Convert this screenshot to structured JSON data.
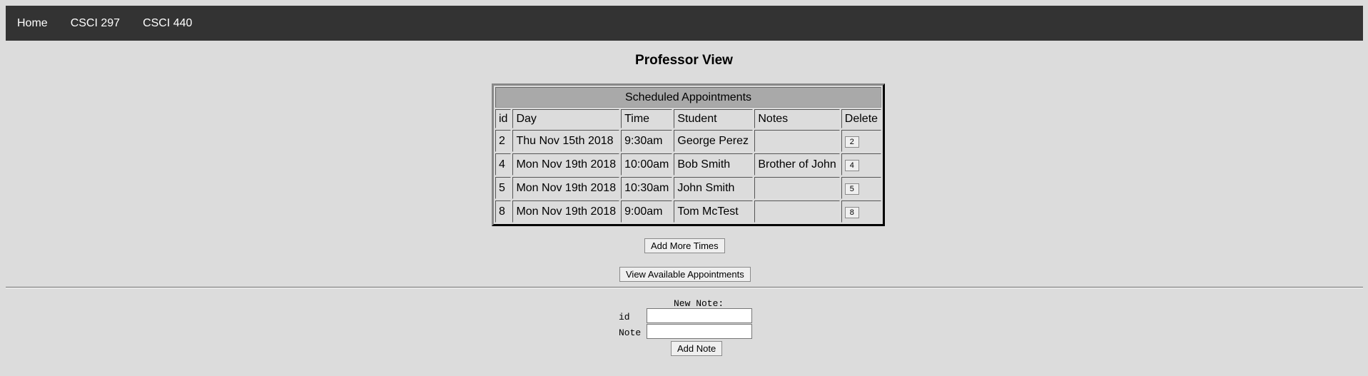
{
  "nav": {
    "links": [
      "Home",
      "CSCI 297",
      "CSCI 440"
    ]
  },
  "page": {
    "title": "Professor View"
  },
  "appointments": {
    "caption": "Scheduled Appointments",
    "headers": [
      "id",
      "Day",
      "Time",
      "Student",
      "Notes",
      "Delete"
    ],
    "rows": [
      {
        "id": "2",
        "day": "Thu Nov 15th 2018",
        "time": "9:30am",
        "student": "George Perez",
        "notes": "",
        "delete": "2"
      },
      {
        "id": "4",
        "day": "Mon Nov 19th 2018",
        "time": "10:00am",
        "student": "Bob Smith",
        "notes": "Brother of John",
        "delete": "4"
      },
      {
        "id": "5",
        "day": "Mon Nov 19th 2018",
        "time": "10:30am",
        "student": "John Smith",
        "notes": "",
        "delete": "5"
      },
      {
        "id": "8",
        "day": "Mon Nov 19th 2018",
        "time": "9:00am",
        "student": "Tom McTest",
        "notes": "",
        "delete": "8"
      }
    ]
  },
  "actions": {
    "add_more_times": "Add More Times",
    "view_available": "View Available Appointments"
  },
  "new_note": {
    "title": "New Note:",
    "id_label": "id",
    "note_label": "Note",
    "id_value": "",
    "note_value": "",
    "submit_label": "Add Note"
  },
  "colors": {
    "navbar": "#333333",
    "background": "#dcdcdc",
    "caption_bg": "#a9a9a9"
  }
}
